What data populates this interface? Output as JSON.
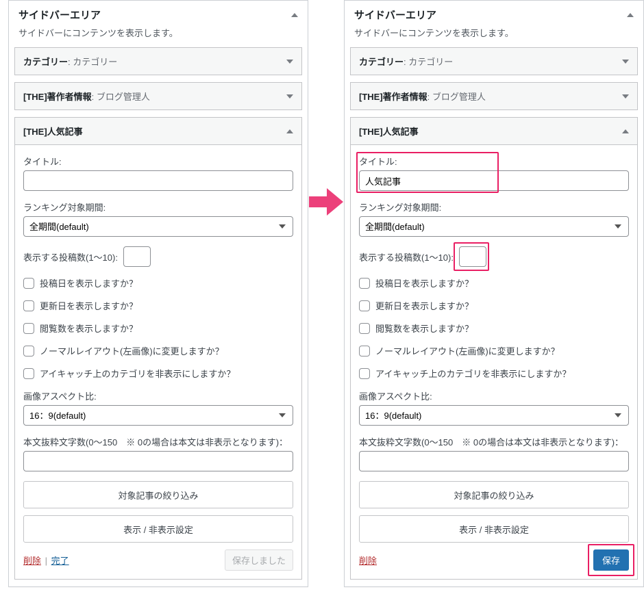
{
  "panel": {
    "title": "サイドバーエリア",
    "desc": "サイドバーにコンテンツを表示します。"
  },
  "widgets": {
    "cat": {
      "name": "カテゴリー",
      "sub": "カテゴリー"
    },
    "author": {
      "name": "[THE]著作者情報",
      "sub": "ブログ管理人"
    },
    "popular": {
      "name": "[THE]人気記事"
    }
  },
  "form": {
    "title_label": "タイトル:",
    "title_value_left": "",
    "title_value_right": "人気記事",
    "period_label": "ランキング対象期間:",
    "period_value": "全期間(default)",
    "count_label": "表示する投稿数(1〜10):",
    "count_value": "",
    "chk_date": "投稿日を表示しますか？",
    "chk_update": "更新日を表示しますか？",
    "chk_views": "閲覧数を表示しますか？",
    "chk_layout": "ノーマルレイアウト(左画像)に変更しますか？",
    "chk_eyecatch": "アイキャッチ上のカテゴリを非表示にしますか？",
    "aspect_label": "画像アスペクト比:",
    "aspect_value": "16：9(default)",
    "excerpt_label": "本文抜粋文字数(0〜150　※ 0の場合は本文は非表示となります)：",
    "excerpt_value": "",
    "filter_btn": "対象記事の絞り込み",
    "visibility_btn": "表示 / 非表示設定"
  },
  "foot": {
    "delete": "削除",
    "done": "完了",
    "saved": "保存しました",
    "save": "保存"
  }
}
